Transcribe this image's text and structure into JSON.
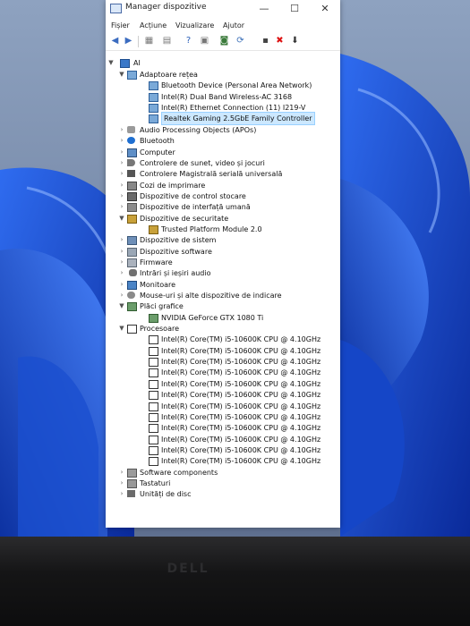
{
  "window": {
    "title": "Manager dispozitive",
    "minimize": "—",
    "maximize": "☐",
    "close": "✕"
  },
  "menu": [
    "Fișier",
    "Acțiune",
    "Vizualizare",
    "Ajutor"
  ],
  "toolbar": {
    "icons": [
      "back-icon",
      "forward-icon",
      "properties-icon",
      "scan-icon",
      "help-icon",
      "driver-icon",
      "monitor-icon",
      "update-driver-icon",
      "disable-icon",
      "uninstall-icon",
      "download-icon"
    ]
  },
  "tree": {
    "root": "AI",
    "items": [
      {
        "label": "Adaptoare rețea",
        "expanded": true,
        "icon": "network-adapter-icon"
      },
      {
        "label": "Bluetooth Device (Personal Area Network)",
        "child": true,
        "icon": "network-adapter-icon"
      },
      {
        "label": "Intel(R) Dual Band Wireless-AC 3168",
        "child": true,
        "icon": "network-adapter-icon"
      },
      {
        "label": "Intel(R) Ethernet Connection (11) I219-V",
        "child": true,
        "icon": "network-adapter-icon"
      },
      {
        "label": "Realtek Gaming 2.5GbE Family Controller",
        "child": true,
        "selected": true,
        "icon": "network-adapter-icon"
      },
      {
        "label": "Audio Processing Objects (APOs)",
        "icon": "audio-icon"
      },
      {
        "label": "Bluetooth",
        "icon": "bluetooth-icon"
      },
      {
        "label": "Computer",
        "icon": "computer-icon"
      },
      {
        "label": "Controlere de sunet, video și jocuri",
        "icon": "sound-icon"
      },
      {
        "label": "Controlere Magistrală serială universală",
        "icon": "usb-icon"
      },
      {
        "label": "Cozi de imprimare",
        "icon": "printer-icon"
      },
      {
        "label": "Dispozitive de control stocare",
        "icon": "storage-icon"
      },
      {
        "label": "Dispozitive de interfață umană",
        "icon": "hid-icon"
      },
      {
        "label": "Dispozitive de securitate",
        "expanded": true,
        "icon": "security-icon"
      },
      {
        "label": "Trusted Platform Module 2.0",
        "child": true,
        "icon": "security-icon"
      },
      {
        "label": "Dispozitive de sistem",
        "icon": "system-icon"
      },
      {
        "label": "Dispozitive software",
        "icon": "software-icon"
      },
      {
        "label": "Firmware",
        "icon": "firmware-icon"
      },
      {
        "label": "Intrări și ieșiri audio",
        "icon": "microphone-icon"
      },
      {
        "label": "Monitoare",
        "icon": "monitor-icon"
      },
      {
        "label": "Mouse-uri și alte dispozitive de indicare",
        "icon": "mouse-icon"
      },
      {
        "label": "Plăci grafice",
        "expanded": true,
        "icon": "display-adapter-icon"
      },
      {
        "label": "NVIDIA GeForce GTX 1080 Ti",
        "child": true,
        "icon": "display-adapter-icon"
      },
      {
        "label": "Procesoare",
        "expanded": true,
        "icon": "processor-icon"
      },
      {
        "label": "Intel(R) Core(TM) i5-10600K CPU @ 4.10GHz",
        "child": true,
        "icon": "processor-icon"
      },
      {
        "label": "Intel(R) Core(TM) i5-10600K CPU @ 4.10GHz",
        "child": true,
        "icon": "processor-icon"
      },
      {
        "label": "Intel(R) Core(TM) i5-10600K CPU @ 4.10GHz",
        "child": true,
        "icon": "processor-icon"
      },
      {
        "label": "Intel(R) Core(TM) i5-10600K CPU @ 4.10GHz",
        "child": true,
        "icon": "processor-icon"
      },
      {
        "label": "Intel(R) Core(TM) i5-10600K CPU @ 4.10GHz",
        "child": true,
        "icon": "processor-icon"
      },
      {
        "label": "Intel(R) Core(TM) i5-10600K CPU @ 4.10GHz",
        "child": true,
        "icon": "processor-icon"
      },
      {
        "label": "Intel(R) Core(TM) i5-10600K CPU @ 4.10GHz",
        "child": true,
        "icon": "processor-icon"
      },
      {
        "label": "Intel(R) Core(TM) i5-10600K CPU @ 4.10GHz",
        "child": true,
        "icon": "processor-icon"
      },
      {
        "label": "Intel(R) Core(TM) i5-10600K CPU @ 4.10GHz",
        "child": true,
        "icon": "processor-icon"
      },
      {
        "label": "Intel(R) Core(TM) i5-10600K CPU @ 4.10GHz",
        "child": true,
        "icon": "processor-icon"
      },
      {
        "label": "Intel(R) Core(TM) i5-10600K CPU @ 4.10GHz",
        "child": true,
        "icon": "processor-icon"
      },
      {
        "label": "Intel(R) Core(TM) i5-10600K CPU @ 4.10GHz",
        "child": true,
        "icon": "processor-icon"
      },
      {
        "label": "Software components",
        "icon": "component-icon"
      },
      {
        "label": "Tastaturi",
        "icon": "keyboard-icon"
      },
      {
        "label": "Unități de disc",
        "icon": "disk-drive-icon"
      }
    ]
  },
  "bezel": {
    "brand": "DELL"
  },
  "colors": {
    "selection": "#cce8ff",
    "wallpaper_blue": "#1f56d6",
    "bezel": "#151516"
  }
}
